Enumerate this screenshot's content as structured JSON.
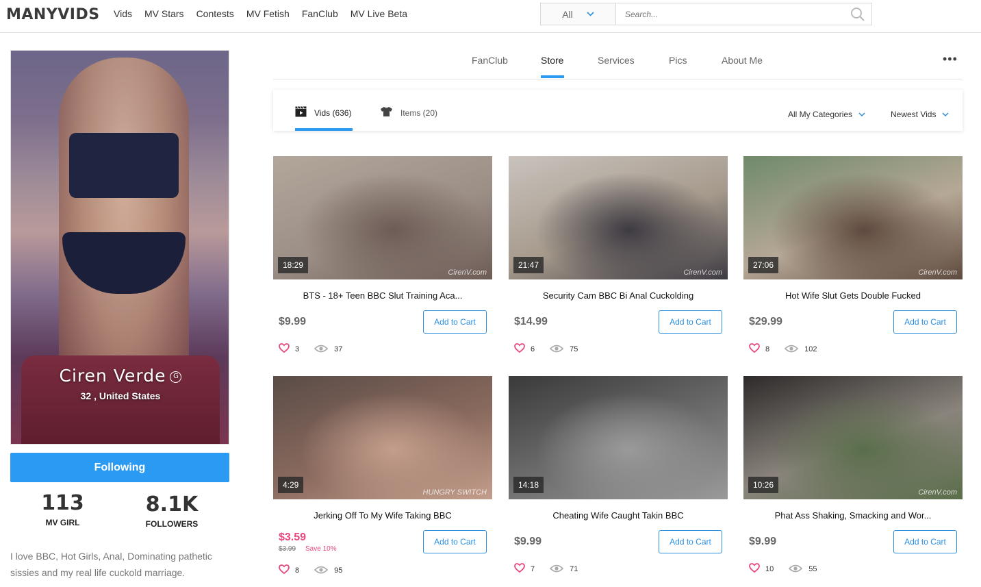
{
  "header": {
    "logo": "MANYVIDS",
    "nav": [
      "Vids",
      "MV Stars",
      "Contests",
      "MV Fetish",
      "FanClub",
      "MV Live Beta"
    ],
    "search": {
      "category": "All",
      "placeholder": "Search..."
    }
  },
  "profile": {
    "name": "Ciren Verde",
    "badge": "G",
    "location": "32 , United States",
    "follow_label": "Following",
    "stats": [
      {
        "value": "113",
        "label": "MV GIRL"
      },
      {
        "value": "8.1K",
        "label": "FOLLOWERS"
      }
    ],
    "bio": "I love BBC, Hot Girls, Anal, Dominating pathetic sissies and my real life cuckold marriage."
  },
  "profile_tabs": {
    "items": [
      "FanClub",
      "Store",
      "Services",
      "Pics",
      "About Me"
    ],
    "active": "Store",
    "more": "•••"
  },
  "store_tabs": {
    "vids": "Vids (636)",
    "items": "Items (20)",
    "category_filter": "All My Categories",
    "sort": "Newest Vids"
  },
  "videos": [
    {
      "title": "BTS - 18+ Teen BBC Slut Training Aca...",
      "duration": "18:29",
      "price": "$9.99",
      "likes": "3",
      "views": "37",
      "watermark": "CirenV.com",
      "colors": [
        "#9c8f86",
        "#6d5c56",
        "#b3a79c"
      ]
    },
    {
      "title": "Security Cam BBC Bi Anal Cuckolding",
      "duration": "21:47",
      "price": "$14.99",
      "likes": "6",
      "views": "75",
      "watermark": "CirenV.com",
      "colors": [
        "#a69a8c",
        "#3d3a42",
        "#c9c3bd"
      ]
    },
    {
      "title": "Hot Wife Slut Gets Double Fucked",
      "duration": "27:06",
      "price": "$29.99",
      "likes": "8",
      "views": "102",
      "watermark": "CirenV.com",
      "colors": [
        "#b6a896",
        "#5e4a3e",
        "#6f8a6a"
      ]
    },
    {
      "title": "Jerking Off To My Wife Taking BBC",
      "duration": "4:29",
      "price": "$3.59",
      "old_price": "$3.99",
      "save": "Save 10%",
      "likes": "8",
      "views": "95",
      "watermark": "HUNGRY SWITCH",
      "colors": [
        "#8a6a5e",
        "#c49e8c",
        "#5a4c47"
      ]
    },
    {
      "title": "Cheating Wife Caught Takin BBC",
      "duration": "14:18",
      "price": "$9.99",
      "likes": "7",
      "views": "71",
      "watermark": "",
      "colors": [
        "#6e6e6e",
        "#9a9a9a",
        "#3a3a3a"
      ]
    },
    {
      "title": "Phat Ass Shaking, Smacking and Wor...",
      "duration": "10:26",
      "price": "$9.99",
      "likes": "10",
      "views": "55",
      "watermark": "CirenV.com",
      "colors": [
        "#8a847c",
        "#5a6e4a",
        "#2d2a2a"
      ]
    }
  ],
  "add_to_cart_label": "Add to Cart",
  "accent": "#2b9af3",
  "like_color": "#e8487b"
}
